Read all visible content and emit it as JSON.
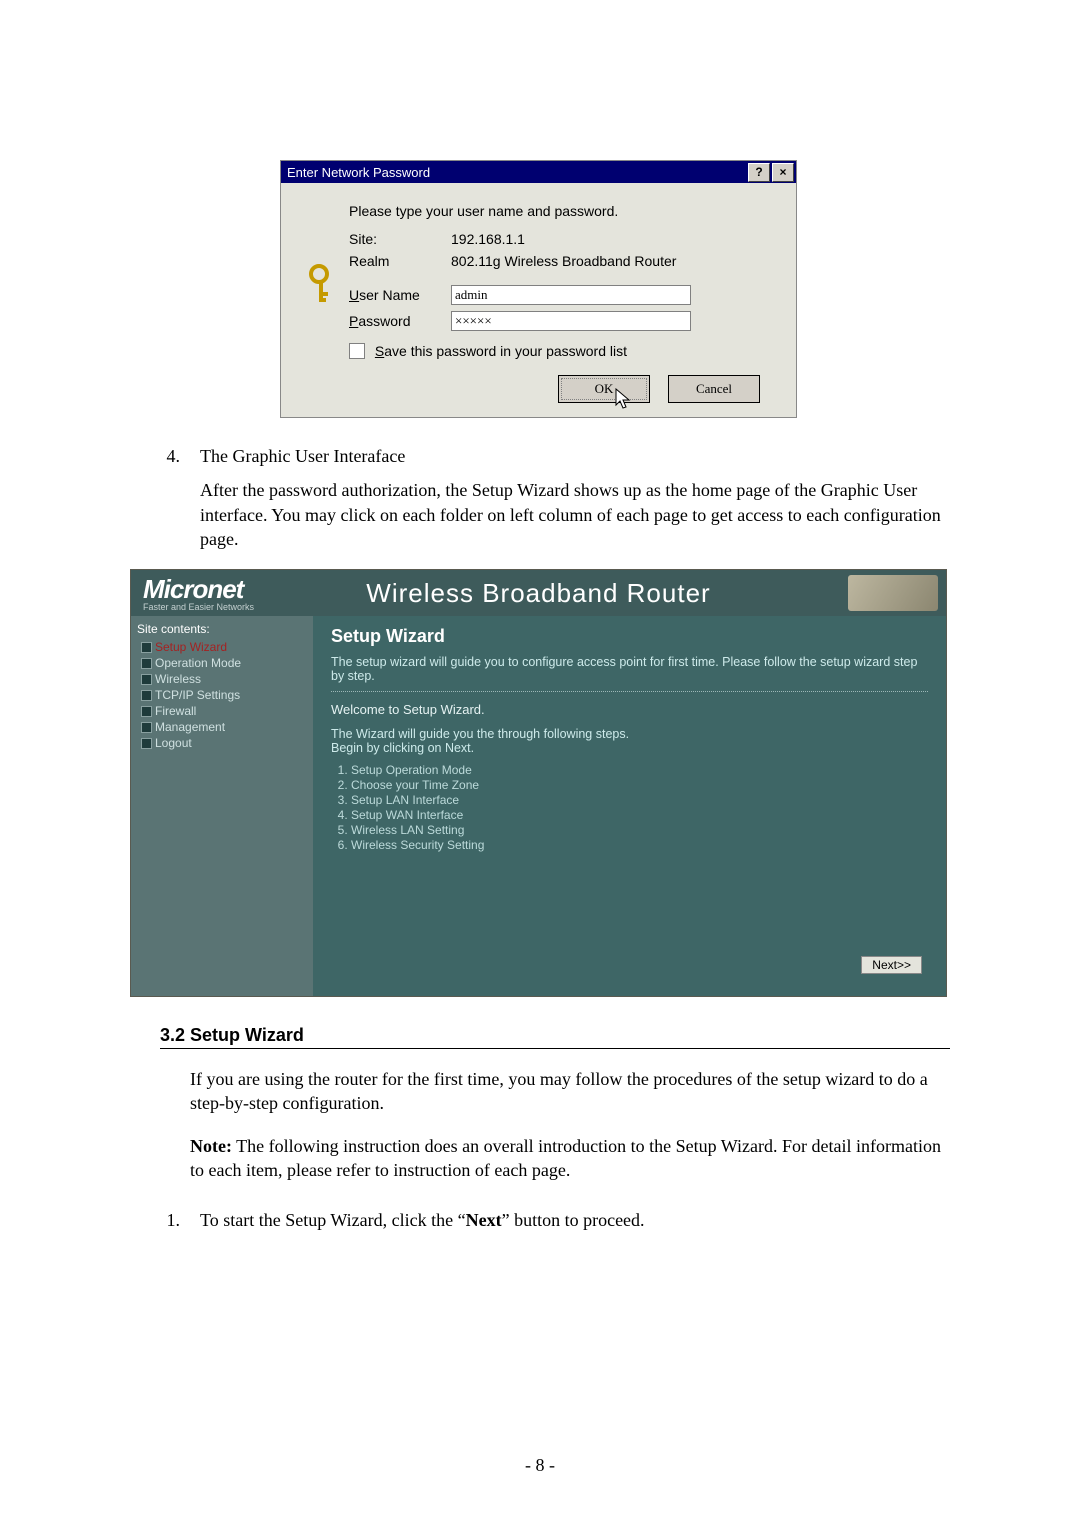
{
  "dialog": {
    "title": "Enter Network Password",
    "help_btn": "?",
    "close_btn": "×",
    "prompt": "Please type your user name and password.",
    "site_label": "Site:",
    "site_value": "192.168.1.1",
    "realm_label": "Realm",
    "realm_value": "802.11g Wireless Broadband Router",
    "user_label_pre": "U",
    "user_label_post": "ser Name",
    "user_value": "admin",
    "pass_label_pre": "P",
    "pass_label_post": "assword",
    "pass_value": "×××××",
    "save_pre": "S",
    "save_post": "ave this password in your password list",
    "ok": "OK",
    "cancel": "Cancel"
  },
  "doc": {
    "item4_num": "4.",
    "item4_title": "The Graphic User Interaface",
    "item4_body": "After the password authorization, the Setup Wizard shows up as the home page of the Graphic User interface. You may click on each folder on left column of each page to get access to each configuration page.",
    "sec32": "3.2 Setup Wizard",
    "p1": "If you are using the router for the first time, you may follow the procedures of the setup wizard to do a step-by-step configuration.",
    "note_label": "Note:",
    "note_body": " The following instruction does an overall introduction to the Setup Wizard. For detail information to each item, please refer to instruction of each page.",
    "item1_num": "1.",
    "item1_pre": "To start the Setup Wizard, click the “",
    "item1_bold": "Next",
    "item1_post": "” button to proceed.",
    "page_number": "- 8 -"
  },
  "router": {
    "logo": "Micronet",
    "logo_sub": "Faster and Easier Networks",
    "header_title": "Wireless Broadband Router",
    "sidebar_root": "Site contents:",
    "sidebar_items": [
      "Setup Wizard",
      "Operation Mode",
      "Wireless",
      "TCP/IP Settings",
      "Firewall",
      "Management",
      "Logout"
    ],
    "main_heading": "Setup Wizard",
    "main_intro": "The setup wizard will guide you to configure access point for first time. Please follow the setup wizard step by step.",
    "welcome": "Welcome to Setup Wizard.",
    "begin1": "The Wizard will guide you the through following steps.",
    "begin2": "Begin by clicking on Next.",
    "steps": [
      "Setup Operation Mode",
      "Choose your Time Zone",
      "Setup LAN Interface",
      "Setup WAN Interface",
      "Wireless LAN Setting",
      "Wireless Security Setting"
    ],
    "next_btn": "Next>>"
  }
}
